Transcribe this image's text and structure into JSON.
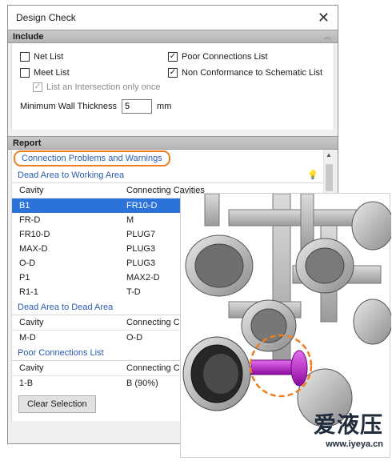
{
  "window": {
    "title": "Design Check"
  },
  "include": {
    "header": "Include",
    "net_list": "Net List",
    "meet_list": "Meet List",
    "list_intersection": "List an Intersection only once",
    "poor_connections": "Poor Connections List",
    "non_conformance": "Non Conformance to Schematic List",
    "min_wall_label": "Minimum Wall Thickness",
    "min_wall_value": "5",
    "unit": "mm"
  },
  "report": {
    "header": "Report",
    "connection_title": "Connection Problems and Warnings",
    "dead_to_working": "Dead Area to Working Area",
    "cols": {
      "cavity": "Cavity",
      "connecting": "Connecting Cavities",
      "connecting_short": "Connecting Cavi"
    },
    "rows1": [
      {
        "cavity": "B1",
        "connecting": "FR10-D"
      },
      {
        "cavity": "FR-D",
        "connecting": "M"
      },
      {
        "cavity": "FR10-D",
        "connecting": "PLUG7"
      },
      {
        "cavity": "MAX-D",
        "connecting": "PLUG3"
      },
      {
        "cavity": "O-D",
        "connecting": "PLUG3"
      },
      {
        "cavity": "P1",
        "connecting": "MAX2-D"
      },
      {
        "cavity": "R1-1",
        "connecting": "T-D"
      }
    ],
    "dead_to_dead": "Dead Area to Dead Area",
    "rows2": [
      {
        "cavity": "M-D",
        "connecting": "O-D"
      }
    ],
    "poor_title": "Poor Connections List",
    "rows3": [
      {
        "cavity": "1-B",
        "connecting": "B (90%)"
      }
    ],
    "clear_button": "Clear Selection"
  },
  "watermark": {
    "brand": "爱液压",
    "url": "www.iyeya.cn"
  },
  "colors": {
    "selection": "#2b73d8",
    "link": "#2a5bb0",
    "highlight_ring": "#ef7d1d",
    "pipe_highlight": "#b316c4"
  }
}
